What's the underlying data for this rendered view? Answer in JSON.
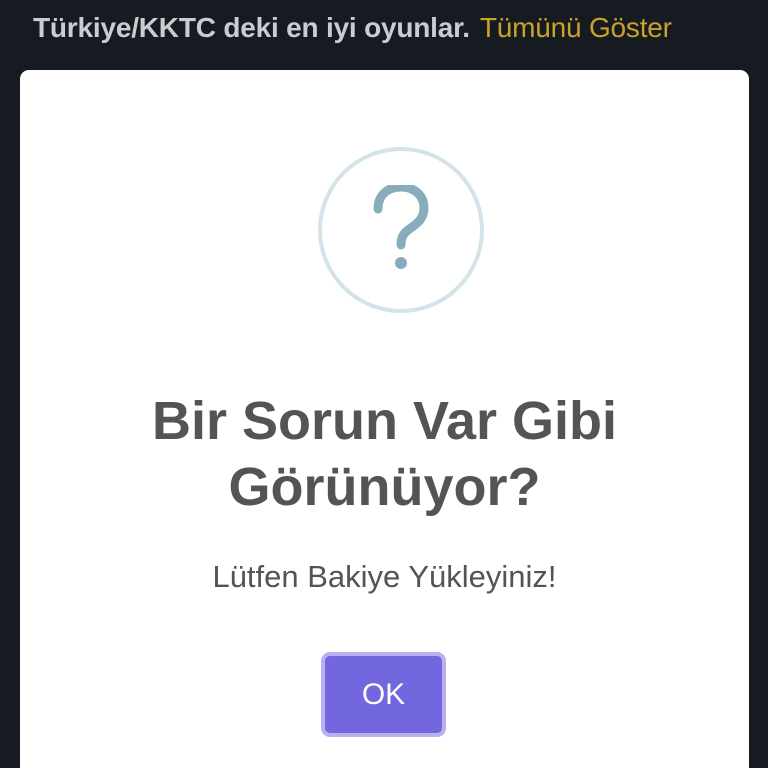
{
  "header": {
    "section_title": "Türkiye/KKTC deki en iyi oyunlar.",
    "show_all_link": "Tümünü Göster"
  },
  "modal": {
    "icon": "question-icon",
    "title": "Bir Sorun Var Gibi Görünüyor?",
    "text": "Lütfen Bakiye Yükleyiniz!",
    "ok_label": "OK"
  },
  "colors": {
    "background": "#161b22",
    "header_text": "#c9ccd1",
    "link": "#c9a227",
    "modal_bg": "#ffffff",
    "icon_ring": "#d4e3ea",
    "icon_glyph": "#87adbd",
    "modal_text": "#545454",
    "button": "#7367e0",
    "button_ring": "#b8b0f0"
  }
}
